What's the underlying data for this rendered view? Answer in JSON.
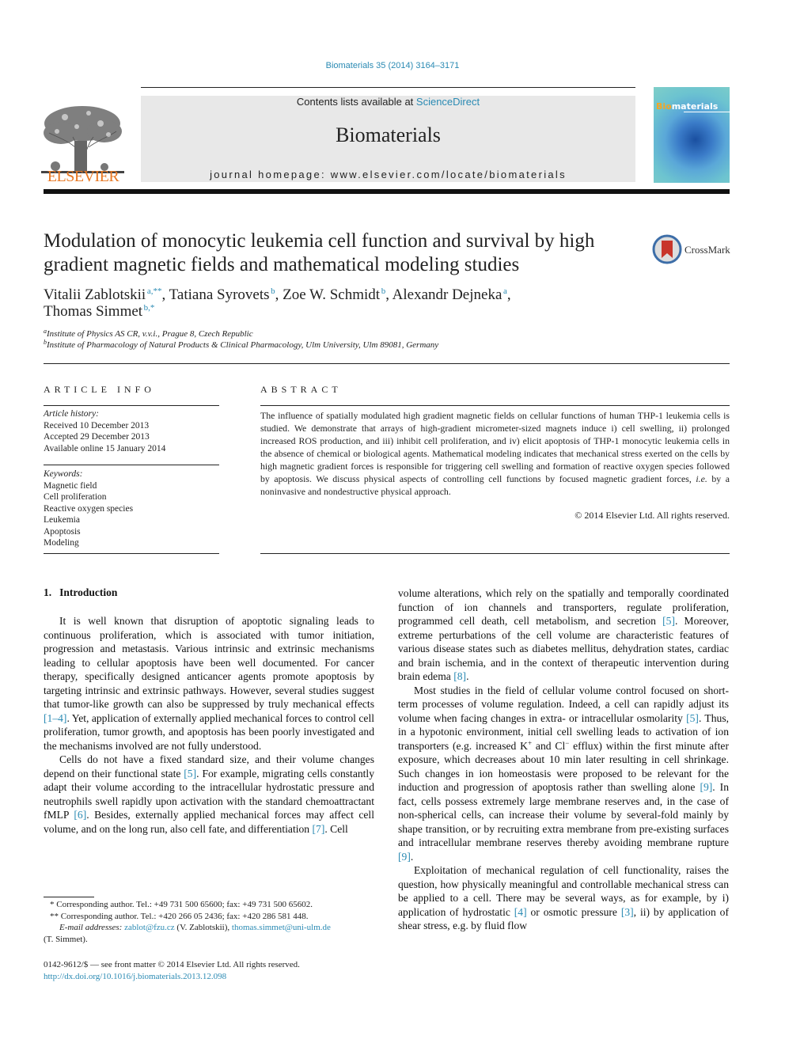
{
  "running_head": "Biomaterials 35 (2014) 3164–3171",
  "header": {
    "contents_prefix": "Contents lists available at ",
    "contents_link": "ScienceDirect",
    "journal_name": "Biomaterials",
    "homepage": "journal homepage: www.elsevier.com/locate/biomaterials",
    "publisher_logo_text": "ELSEVIER",
    "cover_title_highlight": "Bio",
    "cover_title_rest": "materials"
  },
  "article": {
    "title": "Modulation of monocytic leukemia cell function and survival by high gradient magnetic fields and mathematical modeling studies",
    "crossmark_label": "CrossMark",
    "authors": [
      {
        "name": "Vitalii Zablotskii",
        "sup": "a,**",
        "sep": ", "
      },
      {
        "name": "Tatiana Syrovets",
        "sup": "b",
        "sep": ", "
      },
      {
        "name": "Zoe W. Schmidt",
        "sup": "b",
        "sep": ", "
      },
      {
        "name": "Alexandr Dejneka",
        "sup": "a",
        "sep": ","
      },
      {
        "name": "Thomas Simmet",
        "sup": "b,*",
        "sep": ""
      }
    ],
    "affiliations": [
      {
        "key": "a",
        "text": "Institute of Physics AS CR, v.v.i., Prague 8, Czech Republic"
      },
      {
        "key": "b",
        "text": "Institute of Pharmacology of Natural Products & Clinical Pharmacology, Ulm University, Ulm 89081, Germany"
      }
    ]
  },
  "article_info": {
    "heading": "ARTICLE INFO",
    "history_label": "Article history:",
    "history": [
      "Received 10 December 2013",
      "Accepted 29 December 2013",
      "Available online 15 January 2014"
    ],
    "keywords_label": "Keywords:",
    "keywords": [
      "Magnetic field",
      "Cell proliferation",
      "Reactive oxygen species",
      "Leukemia",
      "Apoptosis",
      "Modeling"
    ]
  },
  "abstract": {
    "heading": "ABSTRACT",
    "text_1": "The influence of spatially modulated high gradient magnetic fields on cellular functions of human THP-1 leukemia cells is studied. We demonstrate that arrays of high-gradient micrometer-sized magnets induce i) cell swelling, ii) prolonged increased ROS production, and iii) inhibit cell proliferation, and iv) elicit apoptosis of THP-1 monocytic leukemia cells in the absence of chemical or biological agents. Mathematical modeling indicates that mechanical stress exerted on the cells by high magnetic gradient forces is responsible for triggering cell swelling and formation of reactive oxygen species followed by apoptosis. We discuss physical aspects of controlling cell functions by focused magnetic gradient forces, ",
    "text_ie": "i.e.",
    "text_2": " by a noninvasive and nondestructive physical approach.",
    "copyright": "© 2014 Elsevier Ltd. All rights reserved."
  },
  "body": {
    "section_number": "1.",
    "section_title": "Introduction",
    "left": {
      "p1_a": "It is well known that disruption of apoptotic signaling leads to continuous proliferation, which is associated with tumor initiation, progression and metastasis. Various intrinsic and extrinsic mechanisms leading to cellular apoptosis have been well documented. For cancer therapy, specifically designed anticancer agents promote apoptosis by targeting intrinsic and extrinsic pathways. However, several studies suggest that tumor-like growth can also be suppressed by truly mechanical effects ",
      "p1_ref": "[1–4]",
      "p1_b": ". Yet, application of externally applied mechanical forces to control cell proliferation, tumor growth, and apoptosis has been poorly investigated and the mechanisms involved are not fully understood.",
      "p2_a": "Cells do not have a fixed standard size, and their volume changes depend on their functional state ",
      "p2_ref1": "[5]",
      "p2_b": ". For example, migrating cells constantly adapt their volume according to the intracellular hydrostatic pressure and neutrophils swell rapidly upon activation with the standard chemoattractant fMLP ",
      "p2_ref2": "[6]",
      "p2_c": ". Besides, externally applied mechanical forces may affect cell volume, and on the long run, also cell fate, and differentiation ",
      "p2_ref3": "[7]",
      "p2_d": ". Cell"
    },
    "right": {
      "p1_a": "volume alterations, which rely on the spatially and temporally coordinated function of ion channels and transporters, regulate proliferation, programmed cell death, cell metabolism, and secretion ",
      "p1_ref1": "[5]",
      "p1_b": ". Moreover, extreme perturbations of the cell volume are characteristic features of various disease states such as diabetes mellitus, dehydration states, cardiac and brain ischemia, and in the context of therapeutic intervention during brain edema ",
      "p1_ref2": "[8]",
      "p1_c": ".",
      "p2_a": "Most studies in the field of cellular volume control focused on short-term processes of volume regulation. Indeed, a cell can rapidly adjust its volume when facing changes in extra- or intracellular osmolarity ",
      "p2_ref1": "[5]",
      "p2_b": ". Thus, in a hypotonic environment, initial cell swelling leads to activation of ion transporters (e.g. increased K",
      "p2_sup1": "+",
      "p2_c": " and Cl",
      "p2_sup2": "−",
      "p2_d": " efflux) within the first minute after exposure, which decreases about 10 min later resulting in cell shrinkage. Such changes in ion homeostasis were proposed to be relevant for the induction and progression of apoptosis rather than swelling alone ",
      "p2_ref2": "[9]",
      "p2_e": ". In fact, cells possess extremely large membrane reserves and, in the case of non-spherical cells, can increase their volume by several-fold mainly by shape transition, or by recruiting extra membrane from pre-existing surfaces and intracellular membrane reserves thereby avoiding membrane rupture ",
      "p2_ref3": "[9]",
      "p2_f": ".",
      "p3_a": "Exploitation of mechanical regulation of cell functionality, raises the question, how physically meaningful and controllable mechanical stress can be applied to a cell. There may be several ways, as for example, by i) application of hydrostatic ",
      "p3_ref1": "[4]",
      "p3_b": " or osmotic pressure ",
      "p3_ref2": "[3]",
      "p3_c": ", ii) by application of shear stress, e.g. by fluid flow"
    }
  },
  "footnotes": {
    "fn1": "*  Corresponding author. Tel.: +49 731 500 65600; fax: +49 731 500 65602.",
    "fn2": "** Corresponding author. Tel.: +420 266 05 2436; fax: +420 286 581 448.",
    "email_label": "E-mail addresses:",
    "email1": "zablot@fzu.cz",
    "email1_owner": " (V. Zablotskii), ",
    "email2": "thomas.simmet@uni-ulm.de",
    "email2_owner": "(T. Simmet).",
    "issn_line": "0142-9612/$ — see front matter © 2014 Elsevier Ltd. All rights reserved.",
    "doi": "http://dx.doi.org/10.1016/j.biomaterials.2013.12.098"
  },
  "colors": {
    "link": "#2a8ab3",
    "elsevier_orange": "#e87722",
    "header_band": "#e8e8e8"
  }
}
